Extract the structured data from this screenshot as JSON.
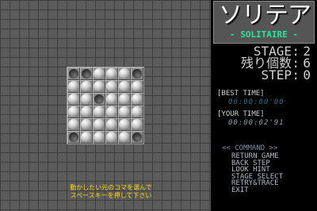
{
  "game": {
    "board_rows": [
      [
        0,
        0,
        1,
        1,
        1,
        0
      ],
      [
        1,
        1,
        1,
        1,
        1,
        1
      ],
      [
        1,
        1,
        0,
        1,
        1,
        1
      ],
      [
        1,
        1,
        1,
        1,
        1,
        1
      ],
      [
        1,
        1,
        1,
        1,
        1,
        1
      ],
      [
        0,
        1,
        1,
        1,
        1,
        0
      ]
    ],
    "hint_line1": "動かしたい元のコマを選んで",
    "hint_line2": "スペースキーを押して下さい"
  },
  "panel": {
    "logo_title": "ソリテア",
    "logo_subtitle": "- SOLITAIRE -",
    "stage_label": "STAGE",
    "stage_value": "2",
    "pieces_label": "残り個数",
    "pieces_value": "6",
    "step_label": "STEP",
    "step_value": "0",
    "colon": ":",
    "best_time_label": "[BEST TIME]",
    "best_time_value": "00:00:00'00",
    "your_time_label": "[YOUR TIME]",
    "your_time_value": "00:00:02'91",
    "command_heading": "<< COMMAND >>",
    "commands": [
      "RETURN GAME",
      "BACK STEP",
      "LOOK HINT",
      "STAGE SELECT",
      "RETRY&TRACE",
      "EXIT"
    ]
  },
  "colors": {
    "board_bg": "#5b5b5b",
    "hint_text": "#ffd800",
    "logo_subtitle": "#25e4a0",
    "best_time": "#1c6f8a"
  }
}
